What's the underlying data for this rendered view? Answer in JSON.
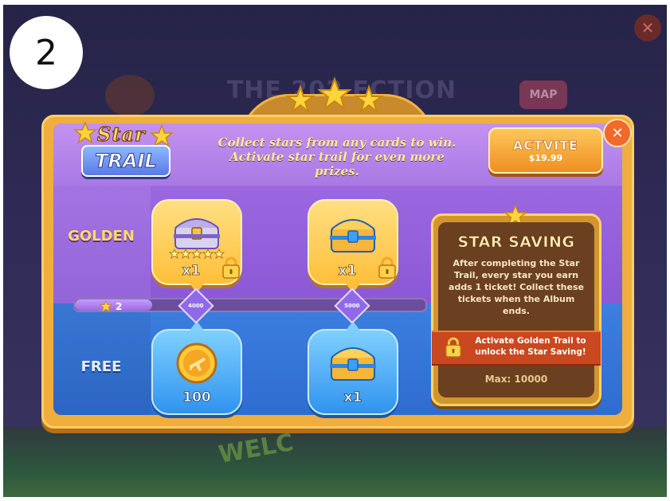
{
  "step_badge": "2",
  "background": {
    "banner": "THE 202 ECTION",
    "map_label": "MAP",
    "close_glyph": "✕",
    "welcome_text": "WELC"
  },
  "logo": {
    "star_word": "Star",
    "trail_word": "TRAIL"
  },
  "header": {
    "line1": "Collect stars from any cards to win.",
    "line2": "Activate star trail for even more prizes."
  },
  "activate_button": {
    "label": "ACTVITE",
    "price": "$19.99"
  },
  "close_button": {
    "glyph": "✕"
  },
  "rows": {
    "golden_label": "GOLDEN",
    "free_label": "FREE"
  },
  "progress": {
    "stars_collected": "2",
    "fill_fraction": 0.22
  },
  "milestones": [
    "4000",
    "5000"
  ],
  "golden_rewards": [
    {
      "icon": "silver-chest-icon",
      "qty": "x1",
      "locked": true,
      "stars": 5
    },
    {
      "icon": "gold-chest-icon",
      "qty": "x1",
      "locked": true
    }
  ],
  "free_rewards": [
    {
      "icon": "airplane-coin-icon",
      "qty": "100"
    },
    {
      "icon": "gold-chest-icon",
      "qty": "x1"
    }
  ],
  "star_saving": {
    "title": "STAR SAVING",
    "desc1": "After completing the Star",
    "desc2": "Trail, every star you earn",
    "desc3": "adds 1 ticket! Collect these",
    "desc4": "tickets when the Album ends.",
    "lock_line1": "Activate Golden Trail to",
    "lock_line2": "unlock the Star Saving!",
    "max": "Max: 10000"
  },
  "colors": {
    "panel_frame": "#f0ae3c",
    "golden_zone": "#8b58d6",
    "free_zone": "#2f6cd0",
    "button_orange": "#ee8f22"
  }
}
